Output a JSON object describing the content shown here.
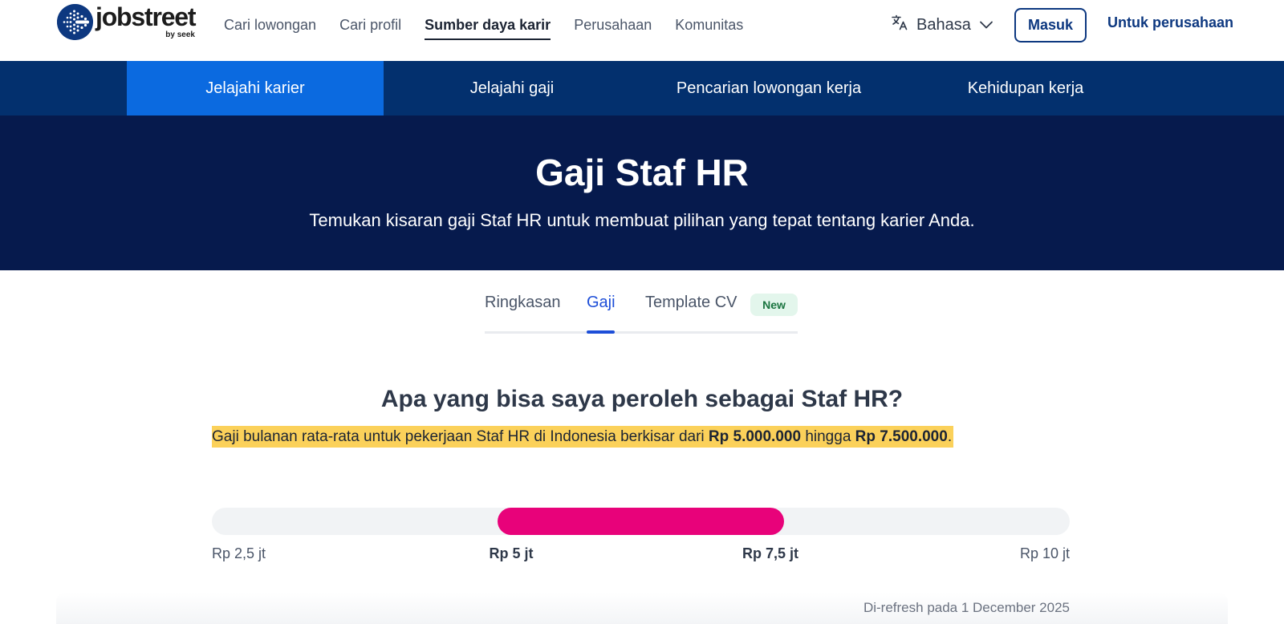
{
  "brand": {
    "name": "jobstreet",
    "sub": "by seek",
    "color": "#0d3880"
  },
  "topnav": {
    "links": [
      {
        "label": "Cari lowongan",
        "active": false
      },
      {
        "label": "Cari profil",
        "active": false
      },
      {
        "label": "Sumber daya karir",
        "active": true
      },
      {
        "label": "Perusahaan",
        "active": false
      },
      {
        "label": "Komunitas",
        "active": false
      }
    ],
    "language_label": "Bahasa",
    "login_label": "Masuk",
    "employer_label": "Untuk perusahaan"
  },
  "subnav": {
    "tabs": [
      {
        "label": "Jelajahi karier",
        "active": true
      },
      {
        "label": "Jelajahi gaji",
        "active": false
      },
      {
        "label": "Pencarian lowongan kerja",
        "active": false
      },
      {
        "label": "Kehidupan kerja",
        "active": false
      }
    ]
  },
  "hero": {
    "title": "Gaji Staf HR",
    "subtitle": "Temukan kisaran gaji Staf HR untuk membuat pilihan yang tepat tentang karier Anda."
  },
  "content_tabs": {
    "items": [
      {
        "label": "Ringkasan",
        "active": false
      },
      {
        "label": "Gaji",
        "active": true
      },
      {
        "label": "Template CV",
        "active": false
      }
    ],
    "badge": "New"
  },
  "salary": {
    "question": "Apa yang bisa saya peroleh sebagai Staf HR?",
    "summary_prefix": "Gaji bulanan rata-rata untuk pekerjaan Staf HR di Indonesia berkisar dari ",
    "summary_low": "Rp 5.000.000",
    "summary_mid": " hingga ",
    "summary_high": "Rp 7.500.000",
    "summary_suffix": ".",
    "range": {
      "scale_min": 2.5,
      "scale_max": 10,
      "low": 5,
      "high": 7.5,
      "unit": "jt"
    },
    "ticks": [
      {
        "label": "Rp 2,5 jt",
        "value": 2.5,
        "bold": false
      },
      {
        "label": "Rp 5 jt",
        "value": 5,
        "bold": true
      },
      {
        "label": "Rp 7,5 jt",
        "value": 7.5,
        "bold": true
      },
      {
        "label": "Rp 10 jt",
        "value": 10,
        "bold": false
      }
    ],
    "refreshed": "Di-refresh pada 1 December 2025",
    "bar_color": "#e8027a",
    "highlight_color": "#fbd15a"
  }
}
